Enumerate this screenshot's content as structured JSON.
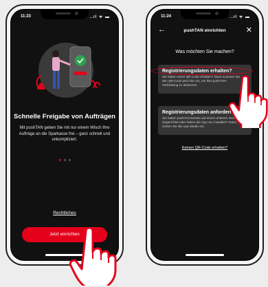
{
  "left_phone": {
    "status": {
      "time": "11:23",
      "icons": "..ıl ᯤ ▬"
    },
    "title": "Schnelle Freigabe von Aufträgen",
    "description": "Mit pushTAN geben Sie mit nur einem Wisch Ihre Aufträge an die Sparkasse frei – ganz schnell und unkompliziert.",
    "pager": {
      "count": 3,
      "active_index": 0
    },
    "legal_link": "Rechtliches",
    "cta_button": "Jetzt einrichten"
  },
  "right_phone": {
    "status": {
      "time": "11:24",
      "icons": "..ıl ᯤ ▬"
    },
    "nav": {
      "back_icon": "←",
      "title": "pushTAN einrichten",
      "close_icon": "✕"
    },
    "heading": "Was möchten Sie machen?",
    "options": [
      {
        "title": "Registrierungsdaten erhalten?",
        "description": "Sie haben einen QR-Code erhalten? Dann scannen Sie den QR-Code jetzt hier ein, um Ihre pushTAN-Verbindung zu aktivieren.",
        "arrow_icon": "→"
      },
      {
        "title": "Registrierungsdaten anfordern?",
        "description": "Sie hatten pushTAN bereits auf einem anderen Gerät eingerichtet oder haben die App neu installiert? Dann richten Sie die App wieder ein.",
        "arrow_icon": "→"
      }
    ],
    "no_qr_link": "Keinen QR-Code erhalten?"
  },
  "colors": {
    "brand_red": "#e4001b",
    "screen_bg": "#111111",
    "card_bg": "#353535"
  }
}
